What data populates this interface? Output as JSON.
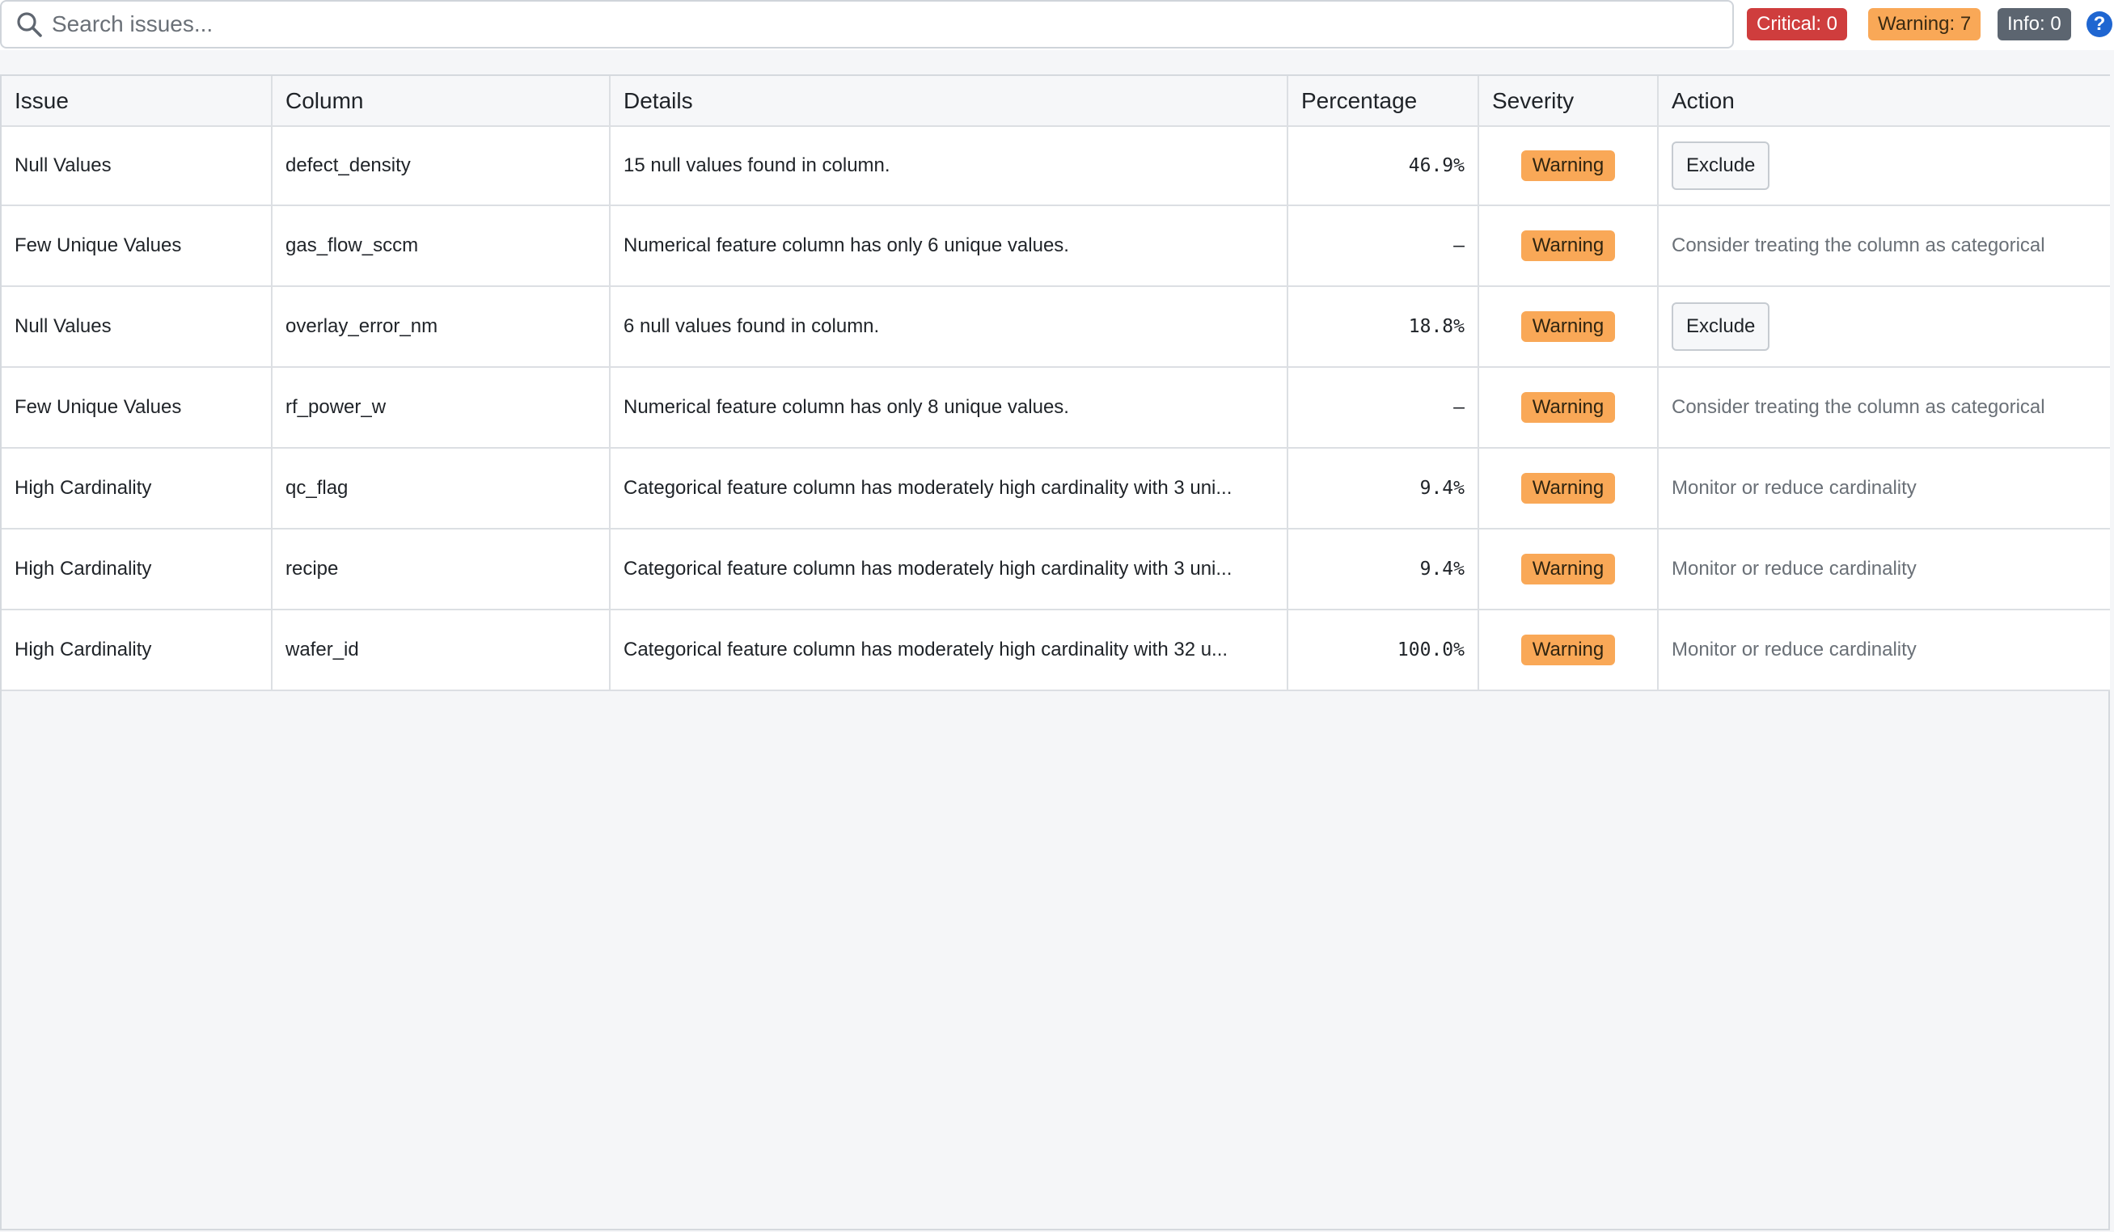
{
  "search": {
    "placeholder": "Search issues..."
  },
  "badges": {
    "critical": "Critical: 0",
    "warning": "Warning: 7",
    "info": "Info: 0"
  },
  "help": {
    "glyph": "?"
  },
  "table": {
    "headers": [
      "Issue",
      "Column",
      "Details",
      "Percentage",
      "Severity",
      "Action"
    ],
    "rows": [
      {
        "issue": "Null Values",
        "column": "defect_density",
        "details": "15 null values found in column.",
        "percentage": "46.9%",
        "severity": "Warning",
        "action": "Exclude",
        "action_type": "button"
      },
      {
        "issue": "Few Unique Values",
        "column": "gas_flow_sccm",
        "details": "Numerical feature column has only 6 unique values.",
        "percentage": "–",
        "severity": "Warning",
        "action": "Consider treating the column as categorical",
        "action_type": "text"
      },
      {
        "issue": "Null Values",
        "column": "overlay_error_nm",
        "details": "6 null values found in column.",
        "percentage": "18.8%",
        "severity": "Warning",
        "action": "Exclude",
        "action_type": "button"
      },
      {
        "issue": "Few Unique Values",
        "column": "rf_power_w",
        "details": "Numerical feature column has only 8 unique values.",
        "percentage": "–",
        "severity": "Warning",
        "action": "Consider treating the column as categorical",
        "action_type": "text"
      },
      {
        "issue": "High Cardinality",
        "column": "qc_flag",
        "details": "Categorical feature column has moderately high cardinality with 3 uni...",
        "percentage": "9.4%",
        "severity": "Warning",
        "action": "Monitor or reduce cardinality",
        "action_type": "text"
      },
      {
        "issue": "High Cardinality",
        "column": "recipe",
        "details": "Categorical feature column has moderately high cardinality with 3 uni...",
        "percentage": "9.4%",
        "severity": "Warning",
        "action": "Monitor or reduce cardinality",
        "action_type": "text"
      },
      {
        "issue": "High Cardinality",
        "column": "wafer_id",
        "details": "Categorical feature column has moderately high cardinality with 32 u...",
        "percentage": "100.0%",
        "severity": "Warning",
        "action": "Monitor or reduce cardinality",
        "action_type": "text"
      }
    ]
  }
}
